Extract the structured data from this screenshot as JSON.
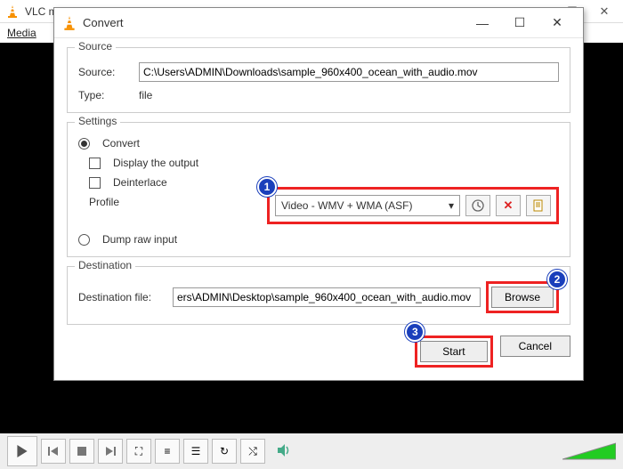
{
  "main": {
    "title": "VLC media player",
    "menu": [
      "Media"
    ]
  },
  "dlg": {
    "title": "Convert",
    "source_group": "Source",
    "source_label": "Source:",
    "source_value": "C:\\Users\\ADMIN\\Downloads\\sample_960x400_ocean_with_audio.mov",
    "type_label": "Type:",
    "type_value": "file",
    "settings_group": "Settings",
    "convert_label": "Convert",
    "display_output_label": "Display the output",
    "deinterlace_label": "Deinterlace",
    "profile_label": "Profile",
    "profile_value": "Video - WMV + WMA (ASF)",
    "dump_label": "Dump raw input",
    "dest_group": "Destination",
    "dest_label": "Destination file:",
    "dest_value": "ers\\ADMIN\\Desktop\\sample_960x400_ocean_with_audio.mov",
    "browse": "Browse",
    "start": "Start",
    "cancel": "Cancel"
  },
  "badges": {
    "one": "1",
    "two": "2",
    "three": "3"
  }
}
